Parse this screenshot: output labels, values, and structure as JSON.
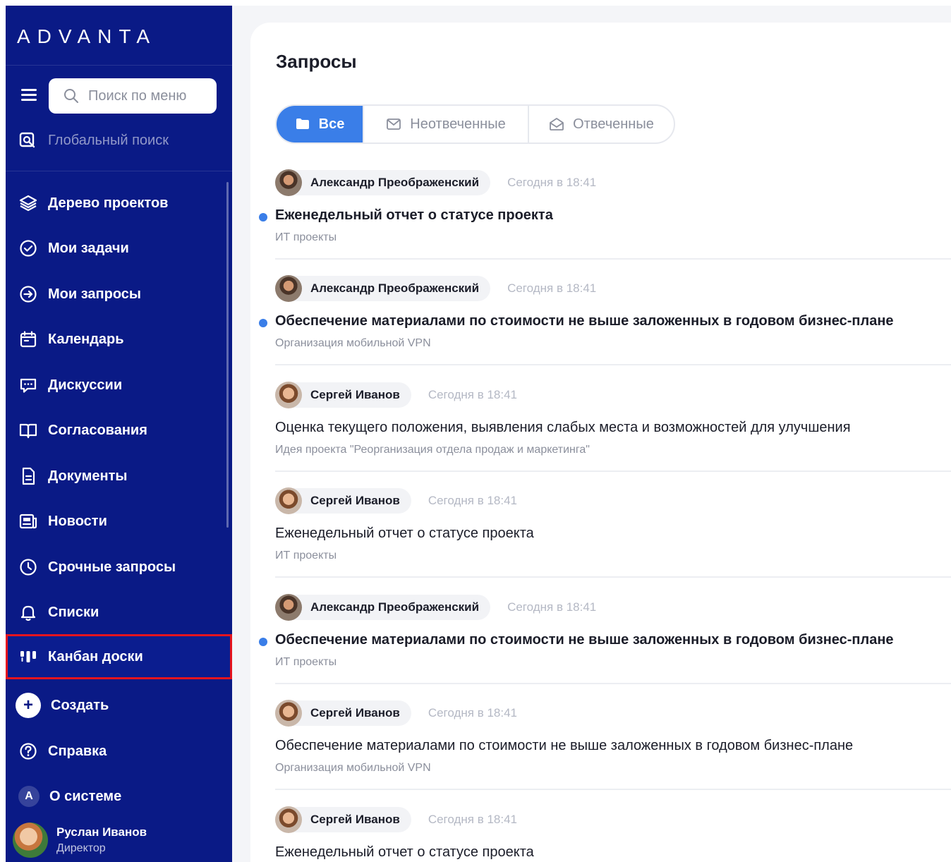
{
  "app": {
    "brand": "ADVANTA"
  },
  "sidebar": {
    "search_placeholder": "Поиск по меню",
    "global_search": "Глобальный поиск",
    "items": [
      {
        "label": "Дерево проектов",
        "icon": "layers-icon"
      },
      {
        "label": "Мои задачи",
        "icon": "check-circle-icon"
      },
      {
        "label": "Мои запросы",
        "icon": "arrow-circle-icon"
      },
      {
        "label": "Календарь",
        "icon": "calendar-icon"
      },
      {
        "label": "Дискуссии",
        "icon": "chat-icon"
      },
      {
        "label": "Согласования",
        "icon": "book-icon"
      },
      {
        "label": "Документы",
        "icon": "document-icon"
      },
      {
        "label": "Новости",
        "icon": "news-icon"
      },
      {
        "label": "Срочные запросы",
        "icon": "clock-icon"
      },
      {
        "label": "Списки",
        "icon": "bell-icon"
      },
      {
        "label": "Канбан доски",
        "icon": "kanban-icon",
        "active": true
      }
    ],
    "create_label": "Создать",
    "help_label": "Справка",
    "about_label": "О системе",
    "user": {
      "name": "Руслан Иванов",
      "role": "Директор"
    }
  },
  "main": {
    "title": "Запросы",
    "tabs": [
      {
        "label": "Все",
        "active": true
      },
      {
        "label": "Неотвеченные",
        "active": false
      },
      {
        "label": "Отвеченные",
        "active": false
      }
    ],
    "requests": [
      {
        "author": "Александр Преображенский",
        "time": "Сегодня в 18:41",
        "title": "Еженедельный отчет о статусе проекта",
        "project": "ИТ проекты",
        "unread": true
      },
      {
        "author": "Александр Преображенский",
        "time": "Сегодня в 18:41",
        "title": "Обеспечение материалами по стоимости не выше заложенных в годовом бизнес-плане",
        "project": "Организация мобильной VPN",
        "unread": true
      },
      {
        "author": "Сергей Иванов",
        "time": "Сегодня в 18:41",
        "title": "Оценка текущего положения, выявления слабых места и возможностей для улучшения",
        "project": "Идея проекта \"Реорганизация отдела продаж и маркетинга\"",
        "unread": false
      },
      {
        "author": "Сергей Иванов",
        "time": "Сегодня в 18:41",
        "title": "Еженедельный отчет о статусе проекта",
        "project": "ИТ проекты",
        "unread": false
      },
      {
        "author": "Александр Преображенский",
        "time": "Сегодня в 18:41",
        "title": "Обеспечение материалами по стоимости не выше заложенных в годовом бизнес-плане",
        "project": "ИТ проекты",
        "unread": true
      },
      {
        "author": "Сергей Иванов",
        "time": "Сегодня в 18:41",
        "title": "Обеспечение материалами по стоимости не выше заложенных в годовом бизнес-плане",
        "project": "Организация мобильной VPN",
        "unread": false
      },
      {
        "author": "Сергей Иванов",
        "time": "Сегодня в 18:41",
        "title": "Еженедельный отчет о статусе проекта",
        "project": "",
        "unread": false
      }
    ]
  },
  "colors": {
    "sidebar": "#0a1a86",
    "accent": "#3a7ee8",
    "highlight": "#e4141e"
  }
}
